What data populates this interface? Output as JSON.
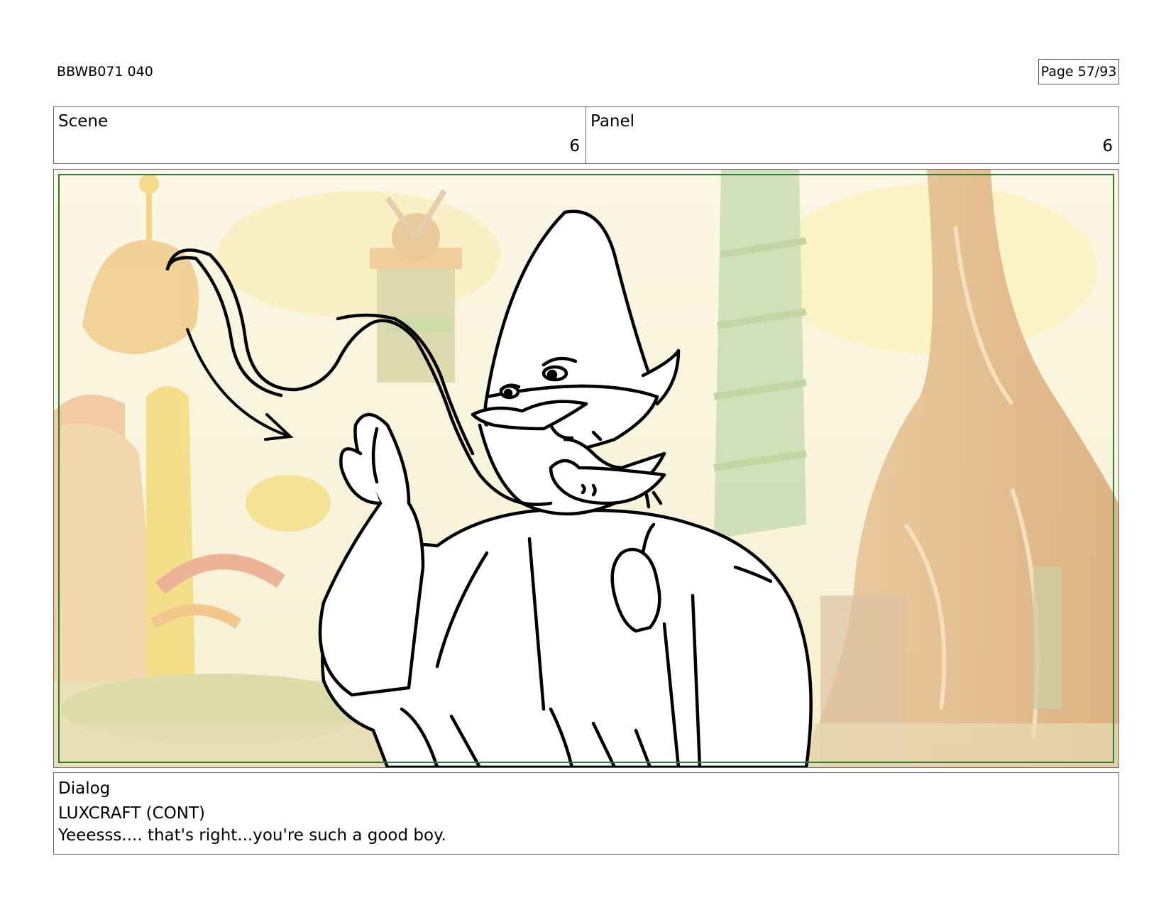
{
  "header": {
    "doc_id": "BBWB071 040",
    "page": "Page 57/93"
  },
  "scene": {
    "label": "Scene",
    "value": "6"
  },
  "panel": {
    "label": "Panel",
    "value": "6"
  },
  "dialog": {
    "label": "Dialog",
    "speaker": "LUXCRAFT (CONT)",
    "line": "Yeeesss.... that's right...you're such a good boy."
  },
  "colors": {
    "safe_frame": "#2e7d32",
    "border": "#666666"
  }
}
